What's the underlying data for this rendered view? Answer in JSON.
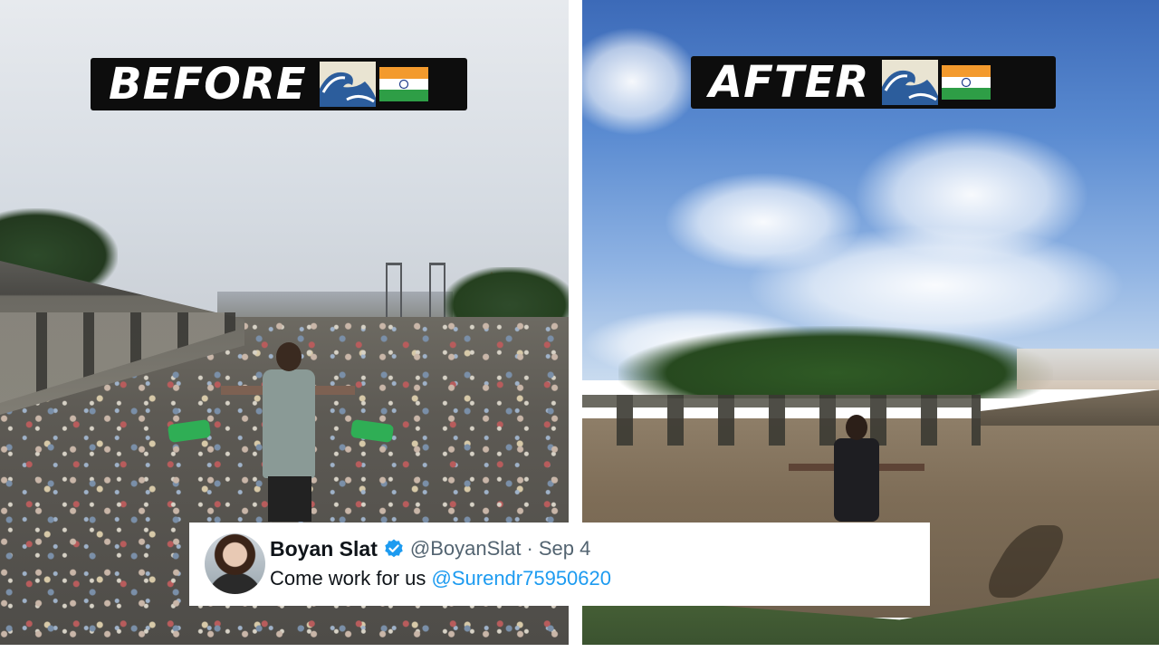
{
  "before": {
    "label": "BEFORE",
    "icons": [
      "water-wave-icon",
      "india-flag-icon"
    ]
  },
  "after": {
    "label": "AFTER",
    "icons": [
      "water-wave-icon",
      "india-flag-icon"
    ]
  },
  "tweet": {
    "name": "Boyan Slat",
    "verified": true,
    "handle": "@BoyanSlat",
    "separator": "·",
    "date": "Sep 4",
    "text": "Come work for us",
    "mention": "@Surendr75950620"
  },
  "colors": {
    "banner_bg": "#0d0d0d",
    "banner_text": "#ffffff",
    "verified_badge": "#1d9bf0",
    "mention_link": "#1d9bf0",
    "secondary_text": "#536471",
    "primary_text": "#0f1419"
  }
}
